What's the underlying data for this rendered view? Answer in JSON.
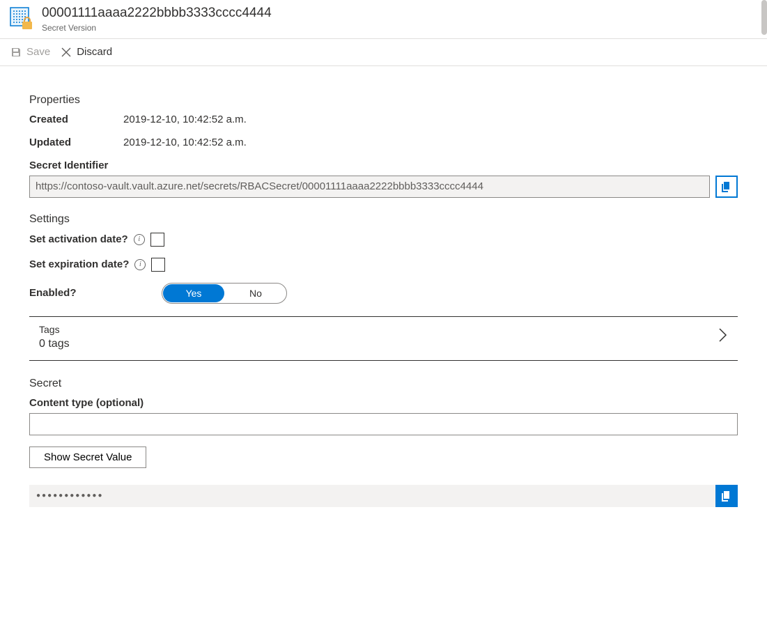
{
  "header": {
    "title": "00001111aaaa2222bbbb3333cccc4444",
    "subtitle": "Secret Version"
  },
  "commandbar": {
    "save": "Save",
    "discard": "Discard"
  },
  "properties": {
    "heading": "Properties",
    "created_label": "Created",
    "created_value": "2019-12-10, 10:42:52 a.m.",
    "updated_label": "Updated",
    "updated_value": "2019-12-10, 10:42:52 a.m."
  },
  "secret_identifier": {
    "label": "Secret Identifier",
    "value": "https://contoso-vault.vault.azure.net/secrets/RBACSecret/00001111aaaa2222bbbb3333cccc4444"
  },
  "settings": {
    "heading": "Settings",
    "activation_label": "Set activation date?",
    "expiration_label": "Set expiration date?",
    "enabled_label": "Enabled?",
    "yes": "Yes",
    "no": "No"
  },
  "tags": {
    "label": "Tags",
    "count": "0 tags"
  },
  "secret": {
    "heading": "Secret",
    "content_type_label": "Content type (optional)",
    "content_type_value": "",
    "show_button": "Show Secret Value",
    "masked_value": "●●●●●●●●●●●●"
  }
}
